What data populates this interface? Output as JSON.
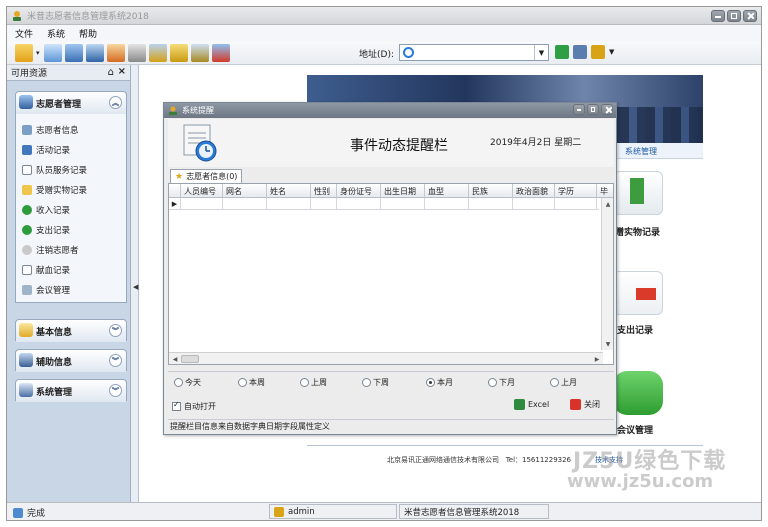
{
  "window": {
    "title": "米昔志愿者信息管理系统2018"
  },
  "menu": [
    "文件",
    "系统",
    "帮助"
  ],
  "address": {
    "label": "地址(D):",
    "value": ""
  },
  "sidebar": {
    "header": "可用资源",
    "groups": [
      {
        "title": "志愿者管理",
        "items": [
          "志愿者信息",
          "活动记录",
          "队员服务记录",
          "受赠实物记录",
          "收入记录",
          "支出记录",
          "注销志愿者",
          "献血记录",
          "会议管理"
        ]
      },
      {
        "title": "基本信息"
      },
      {
        "title": "辅助信息"
      },
      {
        "title": "系统管理"
      }
    ]
  },
  "content": {
    "strip_label": "系统管理",
    "tiles": [
      "赠实物记录",
      "支出记录",
      "会议管理"
    ],
    "footer_company": "北京易讯正通网络通信技术有限公司",
    "footer_tel": "Tel：15611229326",
    "footer_support": "技术支持"
  },
  "dialog": {
    "title": "系统提醒",
    "heading": "事件动态提醒栏",
    "date": "2019年4月2日  星期二",
    "tab_label": "志愿者信息(0)",
    "columns": [
      "人员编号",
      "网名",
      "姓名",
      "性别",
      "身份证号",
      "出生日期",
      "血型",
      "民族",
      "政治面貌",
      "学历",
      "毕"
    ],
    "row_marker": "▶",
    "ranges": [
      "今天",
      "本周",
      "上周",
      "下周",
      "本月",
      "下月",
      "上月"
    ],
    "selected_range": "本月",
    "auto_open_label": "自动打开",
    "excel_label": "Excel",
    "close_label": "关闭",
    "footnote": "提醒栏目信息来自数据字典日期字段属性定义"
  },
  "status": {
    "left": "完成",
    "user": "admin",
    "app": "米昔志愿者信息管理系统2018"
  },
  "watermark": {
    "top": "JZ5U绿色下载",
    "bottom": "www.jz5u.com"
  },
  "colors": {
    "accent": "#2a7bd9",
    "sidebar_bg": "#c9d6e6",
    "dialog_title": "#6d7784"
  }
}
